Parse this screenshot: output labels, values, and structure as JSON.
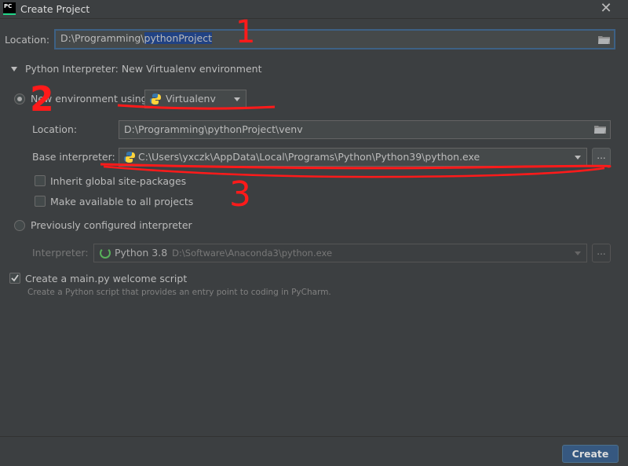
{
  "window": {
    "app_icon_text": "PC",
    "title": "Create Project",
    "close_glyph": "✕"
  },
  "location": {
    "label": "Location:",
    "value_prefix": "D:\\Programming\\",
    "value_selected": "pythonProject"
  },
  "interpreter_section": {
    "header": "Python Interpreter: New Virtualenv environment",
    "new_env": {
      "label": "New environment using",
      "tool": "Virtualenv",
      "selected": true,
      "location_label": "Location:",
      "location_value": "D:\\Programming\\pythonProject\\venv",
      "base_label": "Base interpreter:",
      "base_value": "C:\\Users\\yxczk\\AppData\\Local\\Programs\\Python\\Python39\\python.exe",
      "browse_label": "...",
      "inherit_label": "Inherit global site-packages",
      "inherit_checked": false,
      "available_label": "Make available to all projects",
      "available_checked": false
    },
    "previous": {
      "label": "Previously configured interpreter",
      "selected": false,
      "interpreter_label": "Interpreter:",
      "interpreter_name": "Python 3.8",
      "interpreter_path": "D:\\Software\\Anaconda3\\python.exe",
      "browse_label": "..."
    }
  },
  "welcome": {
    "label": "Create a main.py welcome script",
    "checked": true,
    "hint": "Create a Python script that provides an entry point to coding in PyCharm."
  },
  "footer": {
    "create_label": "Create"
  },
  "annotations": {
    "one": "1",
    "two": "2",
    "three": "3"
  },
  "colors": {
    "background": "#3c3f41",
    "field": "#45494a",
    "selection": "#214283",
    "primary_button": "#365880",
    "annotation": "#ff1a1a"
  },
  "icons": [
    "pycharm-logo-icon",
    "close-icon",
    "folder-icon",
    "python-icon",
    "chevron-down-icon",
    "loading-icon",
    "checkmark-icon"
  ]
}
